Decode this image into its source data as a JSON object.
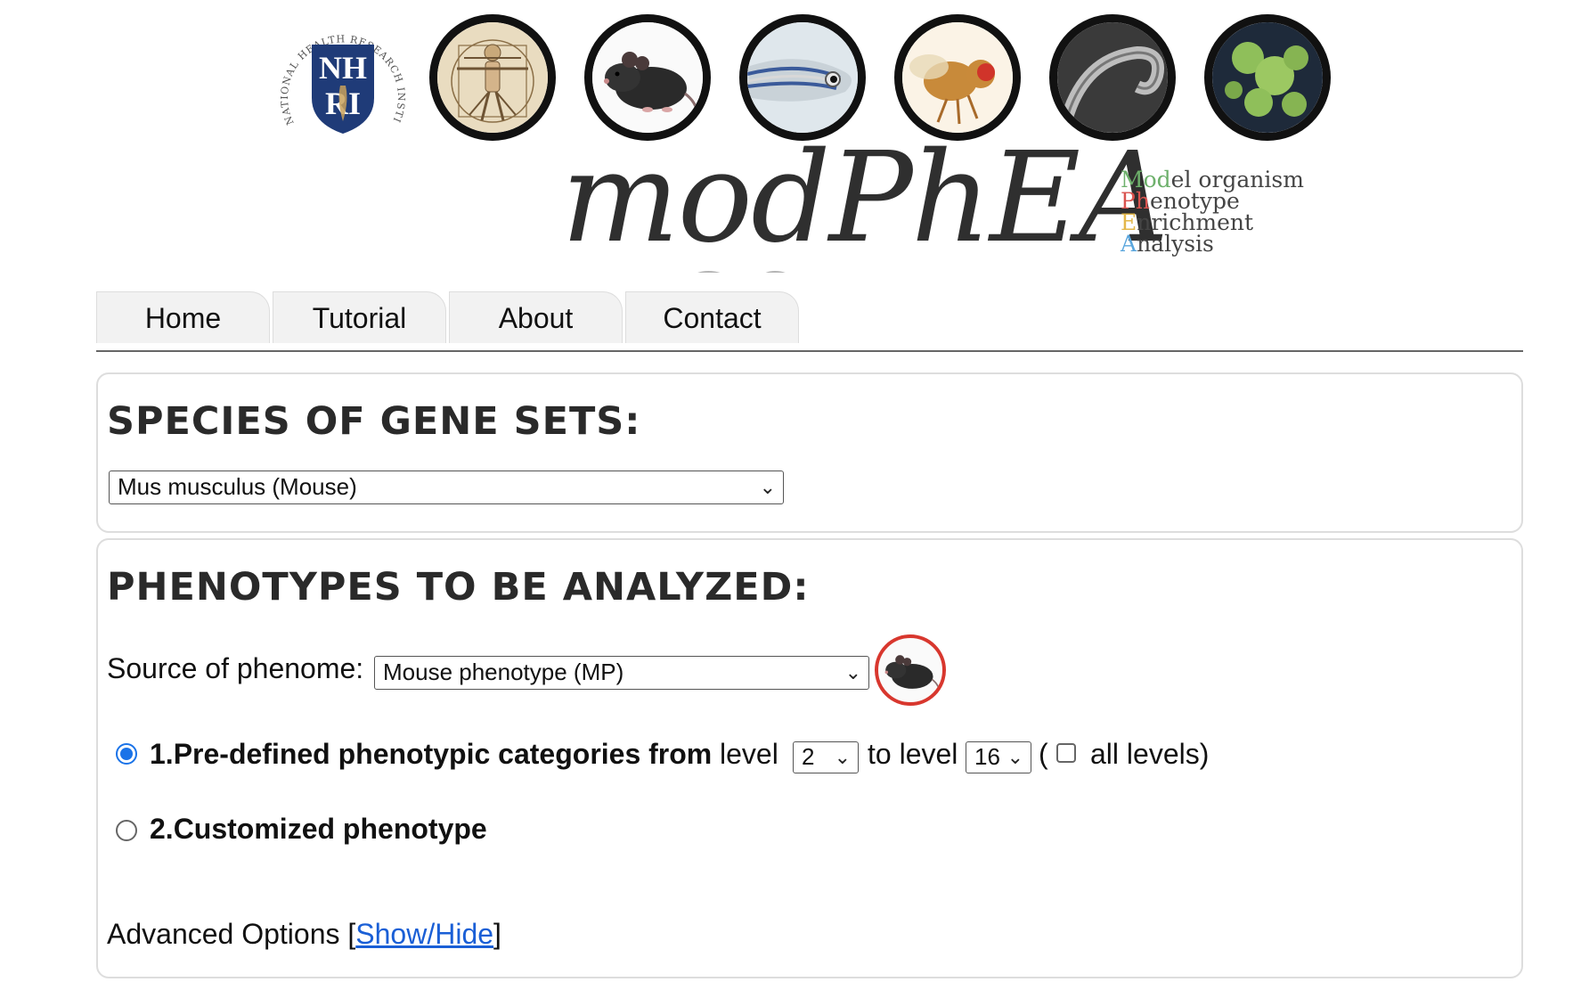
{
  "header": {
    "nhri_logo": {
      "initials_top": "NH",
      "initials_bottom": "RI",
      "ring_text": "NATIONAL HEALTH RESEARCH INSTITUTES"
    },
    "organism_icons": [
      {
        "name": "human",
        "ring_color": "#3a63b0"
      },
      {
        "name": "mouse",
        "ring_color": "#d8372e"
      },
      {
        "name": "zebrafish",
        "ring_color": "#3b9ad9"
      },
      {
        "name": "fly",
        "ring_color": "#4aa53b"
      },
      {
        "name": "worm",
        "ring_color": "#c9448f"
      },
      {
        "name": "yeast",
        "ring_color": "#f2c11c"
      }
    ],
    "brand": {
      "title": "modPhEA",
      "acronym": {
        "line1_hl": "Mod",
        "line1_rest": "el organism",
        "line2_hl": "Ph",
        "line2_rest": "enotype",
        "line3_hl": "E",
        "line3_rest": "nrichment",
        "line4_hl": "A",
        "line4_rest": "nalysis"
      }
    }
  },
  "nav": {
    "tabs": [
      "Home",
      "Tutorial",
      "About",
      "Contact"
    ]
  },
  "species_panel": {
    "title": "SPECIES OF GENE SETS:",
    "select_value": "Mus musculus (Mouse)"
  },
  "phenotype_panel": {
    "title": "PHENOTYPES TO BE ANALYZED:",
    "source_label": "Source of phenome:",
    "source_value": "Mouse phenotype (MP)",
    "option1": {
      "label_bold": "1.Pre-defined phenotypic categories from",
      "level_word": "level",
      "from_level": "2",
      "to_level_word": "to level",
      "to_level": "16",
      "open_paren": "(",
      "all_levels_label": "all levels)",
      "selected": true
    },
    "option2": {
      "label_bold": "2.Customized phenotype",
      "selected": false
    },
    "advanced": {
      "label": "Advanced Options [",
      "link": "Show/Hide",
      "close": "]"
    }
  }
}
